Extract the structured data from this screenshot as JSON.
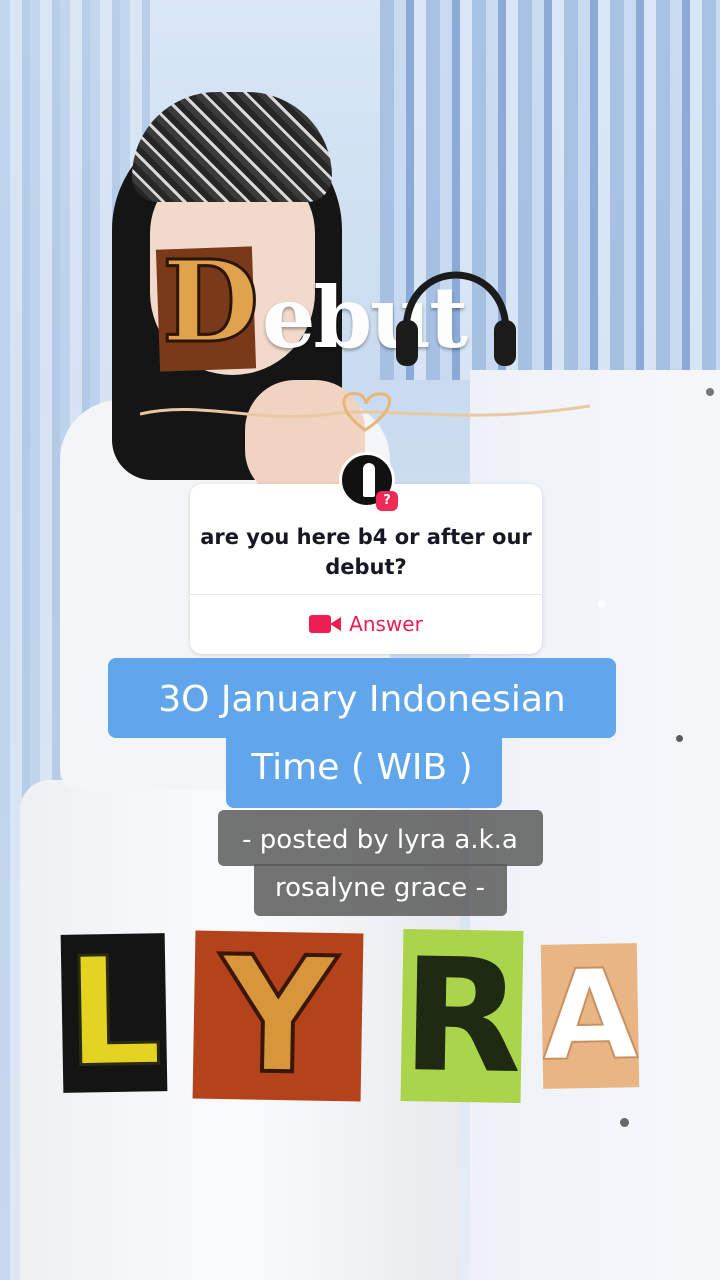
{
  "sticker_title": {
    "first_letter": "D",
    "rest": "ebut"
  },
  "question_sticker": {
    "question": "are you here b4 or after our debut?",
    "badge": "?",
    "answer_label": "Answer",
    "answer_icon": "video-camera-icon"
  },
  "caption_blue": {
    "line1": "3O January Indonesian",
    "line2": "Time ( WIB )"
  },
  "caption_grey": {
    "line1": "- posted by lyra a.k.a",
    "line2": "rosalyne grace -"
  },
  "ransom_letters": [
    "L",
    "Y",
    "R",
    "A"
  ],
  "colors": {
    "caption_blue_bg": "#61a6ea",
    "caption_grey_bg": "#5a5a5a",
    "answer_accent": "#ee1d52"
  }
}
